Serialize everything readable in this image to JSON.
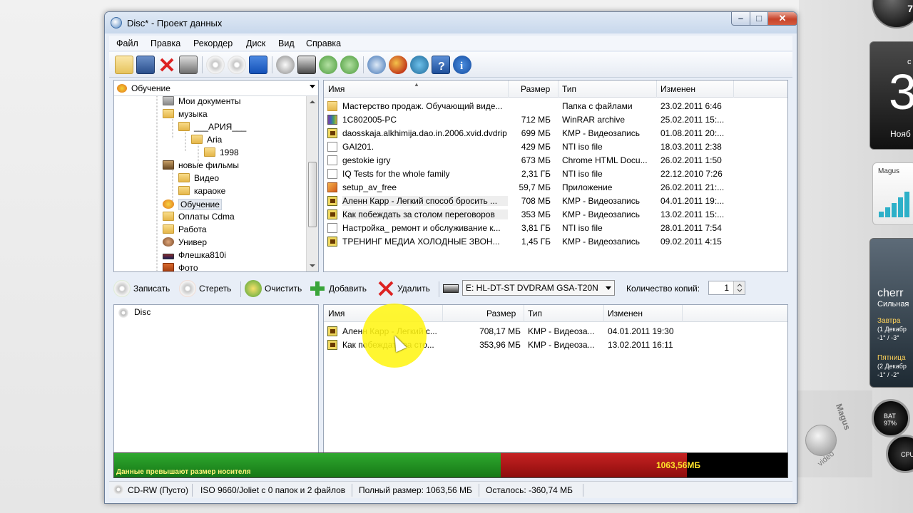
{
  "desktop": {
    "clock_digit": "7",
    "calendar": {
      "top": "c",
      "day": "3",
      "month": "Нояб"
    },
    "net_label": "Magus",
    "weather": {
      "city": "cherr",
      "desc": "Сильная",
      "day1": "Завтра",
      "day1_date": "(1 Декабр",
      "day1_temp": "-1° / -3°",
      "day2": "Пятница",
      "day2_date": "(2 Декабр",
      "day2_temp": "-1° / -2°"
    },
    "meter_label": "BAT 97%",
    "meter_label2": "CPU",
    "watermark1": "Magus",
    "watermark2": "video"
  },
  "window": {
    "title": "Disc* - Проект данных",
    "buttons": {
      "min": "–",
      "max": "□",
      "close": "✕"
    }
  },
  "menu": [
    "Файл",
    "Правка",
    "Рекордер",
    "Диск",
    "Вид",
    "Справка"
  ],
  "toolbar": {
    "icons": [
      "new-project-icon",
      "save-icon",
      "delete-icon",
      "print-icon",
      "erase-disc-icon",
      "burn-disc-icon",
      "blue-square-icon",
      "drive-icon",
      "scanner-icon",
      "refresh-icon",
      "update-icon",
      "settings-icon",
      "browser-icon",
      "web-icon",
      "help-icon",
      "info-icon"
    ]
  },
  "tree": {
    "combo_value": "Обучение",
    "items": [
      {
        "label": "Мои документы",
        "icon": "doc",
        "level": 3
      },
      {
        "label": "музыка",
        "icon": "folder",
        "level": 3
      },
      {
        "label": "___АРИЯ___",
        "icon": "folder",
        "level": 4
      },
      {
        "label": "Aria",
        "icon": "folder",
        "level": 5
      },
      {
        "label": "1998",
        "icon": "folder",
        "level": 6
      },
      {
        "label": "новые фильмы",
        "icon": "film",
        "level": 3
      },
      {
        "label": "Видео",
        "icon": "folder",
        "level": 4
      },
      {
        "label": "караоке",
        "icon": "folder",
        "level": 4
      },
      {
        "label": "Обучение",
        "icon": "edu",
        "level": 3,
        "selected": true
      },
      {
        "label": "Оплаты Cdma",
        "icon": "folder",
        "level": 3
      },
      {
        "label": "Работа",
        "icon": "folder",
        "level": 3
      },
      {
        "label": "Универ",
        "icon": "univ",
        "level": 3
      },
      {
        "label": "Флешка810i",
        "icon": "usb",
        "level": 3
      },
      {
        "label": "Фото",
        "icon": "foto",
        "level": 3
      }
    ]
  },
  "files": {
    "headers": {
      "name": "Имя",
      "size": "Размер",
      "type": "Тип",
      "modified": "Изменен"
    },
    "rows": [
      {
        "name": "Мастерство продаж. Обучающий виде...",
        "size": "",
        "type": "Папка с файлами",
        "modified": "23.02.2011 6:46",
        "icon": "folder"
      },
      {
        "name": "1C802005-PC",
        "size": "712 МБ",
        "type": "WinRAR archive",
        "modified": "25.02.2011 15:...",
        "icon": "rar"
      },
      {
        "name": "daosskaja.alkhimija.dao.in.2006.xvid.dvdrip",
        "size": "699 МБ",
        "type": "KMP - Видеозапись",
        "modified": "01.08.2011 20:...",
        "icon": "avi"
      },
      {
        "name": "GAI201.",
        "size": "429 МБ",
        "type": "NTI iso file",
        "modified": "18.03.2011 2:38",
        "icon": "iso"
      },
      {
        "name": "gestokie igry",
        "size": "673 МБ",
        "type": "Chrome HTML Docu...",
        "modified": "26.02.2011 1:50",
        "icon": "html"
      },
      {
        "name": "IQ Tests for the whole family",
        "size": "2,31 ГБ",
        "type": "NTI iso file",
        "modified": "22.12.2010 7:26",
        "icon": "iso"
      },
      {
        "name": "setup_av_free",
        "size": "59,7 МБ",
        "type": "Приложение",
        "modified": "26.02.2011 21:...",
        "icon": "exe"
      },
      {
        "name": "Аленн Карр - Легкий способ бросить ...",
        "size": "708 МБ",
        "type": "KMP - Видеозапись",
        "modified": "04.01.2011 19:...",
        "icon": "avi",
        "hl": true
      },
      {
        "name": "Как побеждать за столом переговоров",
        "size": "353 МБ",
        "type": "KMP - Видеозапись",
        "modified": "13.02.2011 15:...",
        "icon": "avi",
        "hl": true
      },
      {
        "name": "Настройка_ ремонт и обслуживание к...",
        "size": "3,81 ГБ",
        "type": "NTI iso file",
        "modified": "28.01.2011 7:54",
        "icon": "iso"
      },
      {
        "name": "ТРЕНИНГ МЕДИА ХОЛОДНЫЕ ЗВОН...",
        "size": "1,45 ГБ",
        "type": "KMP - Видеозапись",
        "modified": "09.02.2011 4:15",
        "icon": "avi"
      }
    ]
  },
  "actions": {
    "burn": "Записать",
    "erase": "Стереть",
    "clear": "Очистить",
    "add": "Добавить",
    "remove": "Удалить",
    "drive": "E: HL-DT-ST DVDRAM GSA-T20N",
    "copies_label": "Количество копий:",
    "copies_value": "1"
  },
  "disc": {
    "root": "Disc",
    "headers": {
      "name": "Имя",
      "size": "Размер",
      "type": "Тип",
      "modified": "Изменен"
    },
    "rows": [
      {
        "name": "Аленн Карр - Легкий с...",
        "size": "708,17 МБ",
        "type": "KMP - Видеоза...",
        "modified": "04.01.2011 19:30"
      },
      {
        "name": "Как побеждать за сто...",
        "size": "353,96 МБ",
        "type": "KMP - Видеоза...",
        "modified": "13.02.2011 16:11"
      }
    ]
  },
  "capacity": {
    "message": "Данные превышают размер носителя",
    "amount": "1063,56МБ",
    "fill_fraction_green": 0.574,
    "fill_fraction_red": 0.85,
    "colors": {
      "green": "#1f8f1f",
      "red": "#b51818",
      "text": "#fff37a"
    }
  },
  "status": {
    "media": "CD-RW (Пусто)",
    "fs": "ISO 9660/Joliet с 0 папок и 2 файлов",
    "total": "Полный размер: 1063,56 МБ",
    "remaining": "Осталось: -360,74 МБ"
  }
}
